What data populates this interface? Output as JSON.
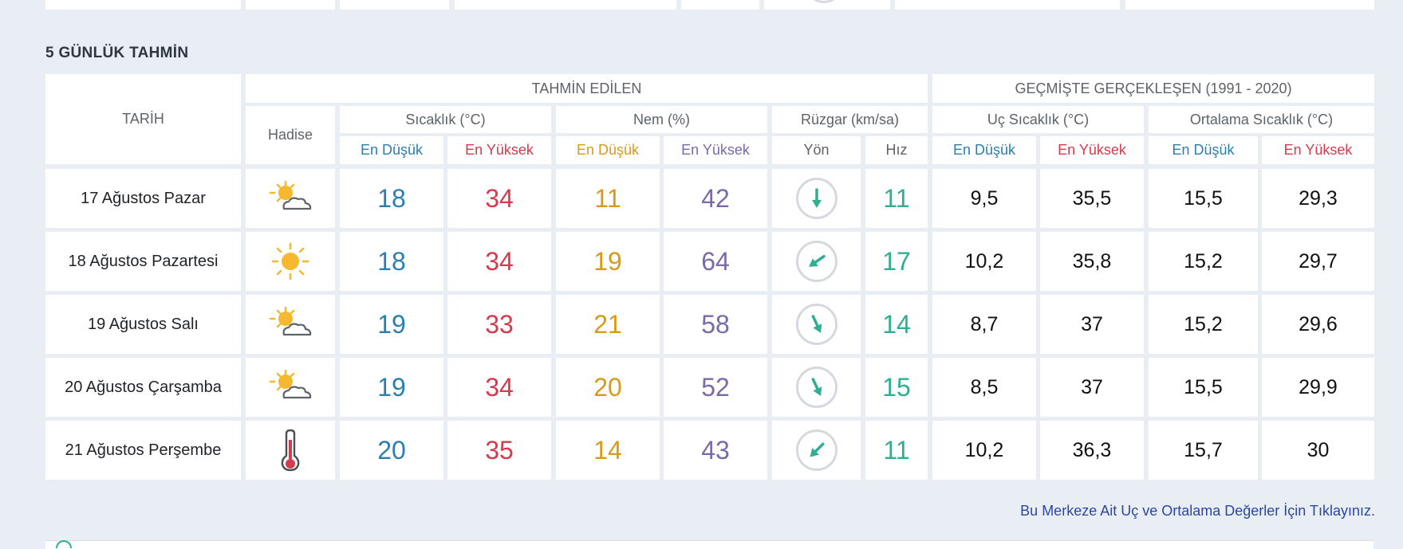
{
  "section_title": "5 GÜNLÜK TAHMİN",
  "headers": {
    "date": "TARİH",
    "forecast_group": "TAHMİN EDİLEN",
    "history_group": "GEÇMİŞTE GERÇEKLEŞEN (1991 - 2020)",
    "event": "Hadise",
    "temperature": "Sıcaklık (°C)",
    "humidity": "Nem (%)",
    "wind": "Rüzgar (km/sa)",
    "extreme_temp": "Uç Sıcaklık (°C)",
    "avg_temp": "Ortalama Sıcaklık (°C)",
    "low": "En Düşük",
    "high": "En Yüksek",
    "direction": "Yön",
    "speed": "Hız"
  },
  "colors": {
    "low": "#2a7fb0",
    "high": "#d63b4d",
    "humidity_low": "#d99a18",
    "humidity_high": "#7a6aa8",
    "wind_speed": "#2fae92"
  },
  "rows": [
    {
      "date": "17 Ağustos Pazar",
      "icon": "partly-cloudy-icon",
      "temp_low": "18",
      "temp_high": "34",
      "hum_low": "11",
      "hum_high": "42",
      "wind_dir": "wind-arrow-south-icon",
      "wind_speed": "11",
      "ext_low": "9,5",
      "ext_high": "35,5",
      "avg_low": "15,5",
      "avg_high": "29,3"
    },
    {
      "date": "18 Ağustos Pazartesi",
      "icon": "sunny-icon",
      "temp_low": "18",
      "temp_high": "34",
      "hum_low": "19",
      "hum_high": "64",
      "wind_dir": "wind-arrow-southwest-icon",
      "wind_speed": "17",
      "ext_low": "10,2",
      "ext_high": "35,8",
      "avg_low": "15,2",
      "avg_high": "29,7"
    },
    {
      "date": "19 Ağustos Salı",
      "icon": "partly-cloudy-icon",
      "temp_low": "19",
      "temp_high": "33",
      "hum_low": "21",
      "hum_high": "58",
      "wind_dir": "wind-arrow-south-southeast-icon",
      "wind_speed": "14",
      "ext_low": "8,7",
      "ext_high": "37",
      "avg_low": "15,2",
      "avg_high": "29,6"
    },
    {
      "date": "20 Ağustos Çarşamba",
      "icon": "partly-cloudy-icon",
      "temp_low": "19",
      "temp_high": "34",
      "hum_low": "20",
      "hum_high": "52",
      "wind_dir": "wind-arrow-south-southeast-icon",
      "wind_speed": "15",
      "ext_low": "8,5",
      "ext_high": "37",
      "avg_low": "15,5",
      "avg_high": "29,9"
    },
    {
      "date": "21 Ağustos Perşembe",
      "icon": "thermometer-hot-icon",
      "temp_low": "20",
      "temp_high": "35",
      "hum_low": "14",
      "hum_high": "43",
      "wind_dir": "wind-arrow-southwest-icon",
      "wind_speed": "11",
      "ext_low": "10,2",
      "ext_high": "36,3",
      "avg_low": "15,7",
      "avg_high": "30"
    }
  ],
  "link_text": "Bu Merkeze Ait Uç ve Ortalama Değerler İçin Tıklayınız."
}
